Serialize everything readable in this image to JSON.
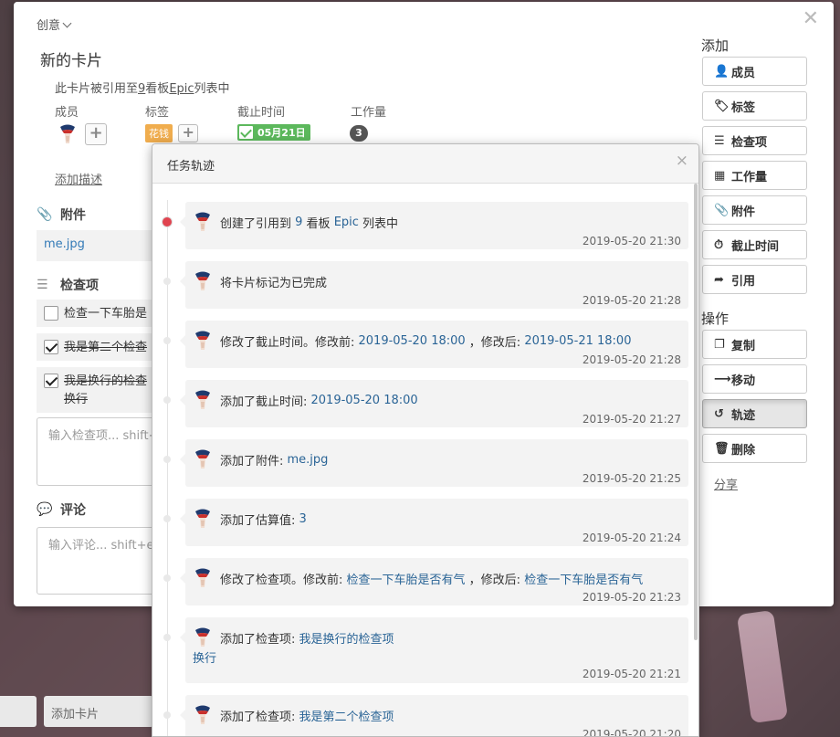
{
  "background": {
    "add_card_label": "添加卡片"
  },
  "card": {
    "board_name": "创意",
    "title": "新的卡片",
    "ref_prefix": "此卡片被引用至",
    "ref_board_number": "9",
    "ref_mid": "看板",
    "ref_list": "Epic",
    "ref_suffix": "列表中",
    "labels": {
      "members": "成员",
      "tags": "标签",
      "due": "截止时间",
      "workload": "工作量"
    },
    "tag_value": "花钱",
    "due_value": "05月21日",
    "workload_value": "3",
    "add_description": "添加描述",
    "attachments_title": "附件",
    "attachment_file": "me.jpg",
    "checklist_title": "检查项",
    "checklist_items": [
      {
        "text": "检查一下车胎是",
        "checked": false
      },
      {
        "text": "我是第二个检查",
        "checked": true
      },
      {
        "text": "我是换行的检查",
        "text2": "换行",
        "checked": true
      }
    ],
    "checklist_placeholder": "输入检查项... shift+",
    "comments_title": "评论",
    "comment_placeholder": "输入评论... shift+e"
  },
  "sidebar": {
    "add_title": "添加",
    "add_buttons": [
      {
        "label": "成员",
        "icon": "user-plus-icon"
      },
      {
        "label": "标签",
        "icon": "tag-icon"
      },
      {
        "label": "检查项",
        "icon": "list-icon"
      },
      {
        "label": "工作量",
        "icon": "grid-icon"
      },
      {
        "label": "附件",
        "icon": "paperclip-icon"
      },
      {
        "label": "截止时间",
        "icon": "clock-icon"
      },
      {
        "label": "引用",
        "icon": "share-icon"
      }
    ],
    "actions_title": "操作",
    "action_buttons": [
      {
        "label": "复制",
        "icon": "copy-icon"
      },
      {
        "label": "移动",
        "icon": "arrow-right-icon"
      },
      {
        "label": "轨迹",
        "icon": "history-icon"
      },
      {
        "label": "删除",
        "icon": "trash-icon"
      }
    ],
    "share_label": "分享"
  },
  "history": {
    "title": "任务轨迹",
    "entries": [
      {
        "parts": [
          [
            "创建了引用到 ",
            false
          ],
          [
            "9",
            true
          ],
          [
            " 看板 ",
            false
          ],
          [
            "Epic",
            true
          ],
          [
            " 列表中",
            false
          ]
        ],
        "time": "2019-05-20 21:30"
      },
      {
        "parts": [
          [
            "将卡片标记为已完成",
            false
          ]
        ],
        "time": "2019-05-20 21:28"
      },
      {
        "parts": [
          [
            "修改了截止时间。修改前: ",
            false
          ],
          [
            "2019-05-20 18:00",
            true
          ],
          [
            " ，修改后: ",
            false
          ],
          [
            "2019-05-21 18:00",
            true
          ]
        ],
        "time": "2019-05-20 21:28"
      },
      {
        "parts": [
          [
            "添加了截止时间: ",
            false
          ],
          [
            "2019-05-20 18:00",
            true
          ]
        ],
        "time": "2019-05-20 21:27"
      },
      {
        "parts": [
          [
            "添加了附件: ",
            false
          ],
          [
            "me.jpg",
            true
          ]
        ],
        "time": "2019-05-20 21:25"
      },
      {
        "parts": [
          [
            "添加了估算值: ",
            false
          ],
          [
            "3",
            true
          ]
        ],
        "time": "2019-05-20 21:24"
      },
      {
        "parts": [
          [
            "修改了检查项。修改前: ",
            false
          ],
          [
            "检查一下车胎是否有气",
            true
          ],
          [
            " ，修改后: ",
            false
          ],
          [
            "检查一下车胎是否有气",
            true
          ]
        ],
        "time": "2019-05-20 21:23"
      },
      {
        "parts": [
          [
            "添加了检查项: ",
            false
          ],
          [
            "我是换行的检查项",
            true
          ]
        ],
        "cont": "换行",
        "time": "2019-05-20 21:21"
      },
      {
        "parts": [
          [
            "添加了检查项: ",
            false
          ],
          [
            "我是第二个检查项",
            true
          ]
        ],
        "time": "2019-05-20 21:20"
      }
    ]
  }
}
